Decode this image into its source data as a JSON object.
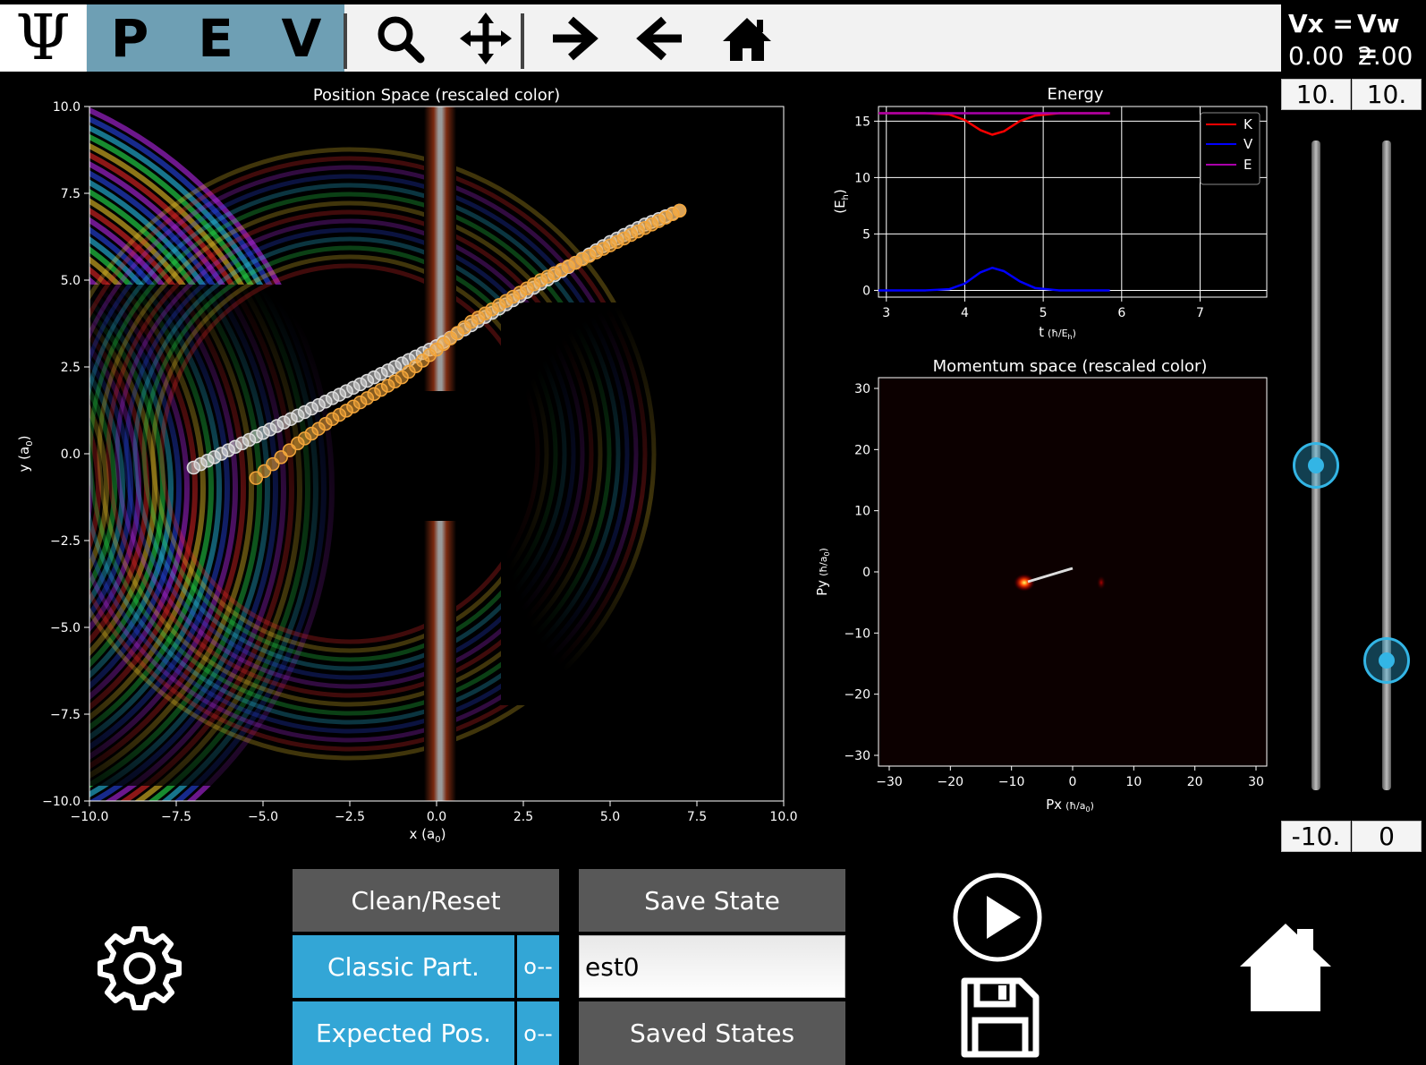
{
  "toolbar": {
    "psi_label": "Ψ",
    "modes": [
      "P",
      "E",
      "V"
    ],
    "icons": [
      "magnifier-icon",
      "pan-arrows-icon",
      "forward-arrow-icon",
      "back-arrow-icon",
      "home-icon"
    ]
  },
  "readout": {
    "vx_label": "Vx =",
    "vw_label": "Vw =",
    "vx_value": "0.00",
    "vw_value": "2.00",
    "vx_max": "10.",
    "vw_max": "10.",
    "vx_min": "-10.",
    "vw_min": "0",
    "vx_slider_level": 0.5,
    "vw_slider_level": 0.2
  },
  "position_plot": {
    "title": "Position Space (rescaled color)",
    "xlabel": "x (a",
    "ylabel": "y (a",
    "sub": "0",
    "xticks": [
      "−10.0",
      "−7.5",
      "−5.0",
      "−2.5",
      "0.0",
      "2.5",
      "5.0",
      "7.5",
      "10.0"
    ],
    "yticks": [
      "10.0",
      "7.5",
      "5.0",
      "2.5",
      "0.0",
      "−2.5",
      "−5.0",
      "−7.5",
      "−10.0"
    ]
  },
  "energy_plot": {
    "title": "Energy",
    "xlabel": "t",
    "ylabel": "(E",
    "xticks": [
      "3",
      "4",
      "5",
      "6",
      "7"
    ],
    "yticks": [
      "15",
      "10",
      "5",
      "0"
    ],
    "legend": [
      "K",
      "V",
      "E"
    ]
  },
  "momentum_plot": {
    "title": "Momentum space (rescaled color)",
    "xlabel": "Px",
    "ylabel": "Py",
    "xticks": [
      "−30",
      "−20",
      "−10",
      "0",
      "10",
      "20",
      "30"
    ],
    "yticks": [
      "30",
      "20",
      "10",
      "0",
      "−10",
      "−20",
      "−30"
    ]
  },
  "controls": {
    "clean_reset": "Clean/Reset",
    "save_state": "Save State",
    "classic_part": "Classic Part.",
    "classic_part_toggle": "o--",
    "expected_pos": "Expected Pos.",
    "expected_pos_toggle": "o--",
    "state_name": "est0",
    "saved_states": "Saved States"
  },
  "chart_data": [
    {
      "type": "line",
      "title": "Energy",
      "xlabel": "t (ħ/E_h)",
      "ylabel": "(E_h)",
      "xlim": [
        2.9,
        7.85
      ],
      "ylim": [
        -0.6,
        16.3
      ],
      "grid": true,
      "legend_position": "top-right",
      "series": [
        {
          "name": "K",
          "color": "#ff0000",
          "x": [
            2.9,
            3.5,
            3.8,
            4.0,
            4.2,
            4.35,
            4.5,
            4.7,
            4.9,
            5.2,
            5.85
          ],
          "y": [
            15.7,
            15.7,
            15.6,
            15.1,
            14.2,
            13.8,
            14.1,
            15.0,
            15.5,
            15.7,
            15.7
          ]
        },
        {
          "name": "V",
          "color": "#0000ff",
          "x": [
            2.9,
            3.5,
            3.8,
            4.0,
            4.2,
            4.35,
            4.5,
            4.7,
            4.9,
            5.2,
            5.85
          ],
          "y": [
            0.0,
            0.0,
            0.1,
            0.6,
            1.6,
            2.0,
            1.7,
            0.8,
            0.2,
            0.0,
            0.0
          ]
        },
        {
          "name": "E",
          "color": "#aa00aa",
          "x": [
            2.9,
            5.85
          ],
          "y": [
            15.7,
            15.7
          ]
        }
      ]
    },
    {
      "type": "scatter",
      "title": "Position Space (rescaled color)",
      "xlabel": "x (a0)",
      "ylabel": "y (a0)",
      "xlim": [
        -10,
        10
      ],
      "ylim": [
        -10,
        10
      ],
      "series": [
        {
          "name": "",
          "color": "#dcdcdc",
          "x": [
            -7.0,
            -6.0,
            -5.0,
            -4.0,
            -3.0,
            -2.0,
            -1.0,
            0.0,
            1.0,
            2.0,
            3.0,
            4.0,
            5.0,
            6.0,
            7.0
          ],
          "y": [
            -0.4,
            0.1,
            0.6,
            1.1,
            1.6,
            2.1,
            2.6,
            3.1,
            3.7,
            4.3,
            4.9,
            5.5,
            6.1,
            6.6,
            7.0
          ]
        },
        {
          "name": "",
          "color": "#f3a53a",
          "x": [
            -5.2,
            -4.0,
            -3.0,
            -2.0,
            -1.0,
            0.0,
            1.0,
            2.0,
            3.0,
            4.0,
            5.0,
            6.0,
            7.0
          ],
          "y": [
            -0.7,
            0.3,
            1.0,
            1.6,
            2.2,
            3.0,
            3.8,
            4.4,
            5.0,
            5.5,
            6.0,
            6.5,
            7.0
          ]
        }
      ]
    }
  ]
}
